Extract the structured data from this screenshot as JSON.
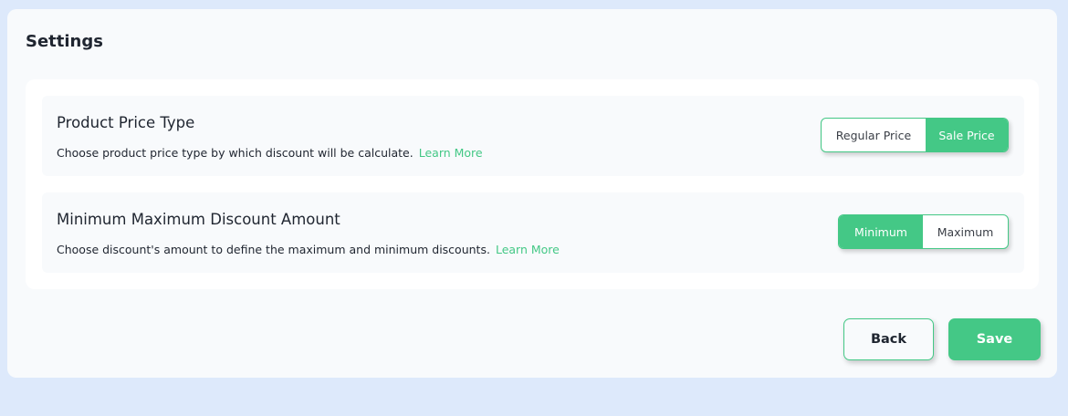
{
  "settings": {
    "title": "Settings",
    "rows": [
      {
        "title": "Product Price Type",
        "description": "Choose product price type by which discount will be calculate.",
        "learn_more": "Learn More",
        "options": [
          "Regular Price",
          "Sale Price"
        ],
        "selected": "Sale Price"
      },
      {
        "title": "Minimum Maximum Discount Amount",
        "description": "Choose discount's amount to define the maximum and minimum discounts.",
        "learn_more": "Learn More",
        "options": [
          "Minimum",
          "Maximum"
        ],
        "selected": "Minimum"
      }
    ],
    "back_label": "Back",
    "save_label": "Save"
  },
  "colors": {
    "accent": "#44c886",
    "page_background": "#dde9fb",
    "panel_background": "#f8fafc"
  }
}
